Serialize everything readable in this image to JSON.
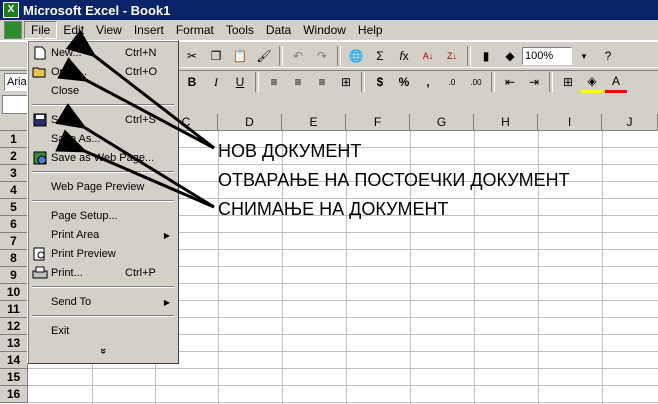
{
  "window": {
    "title": "Microsoft Excel - Book1"
  },
  "menu": [
    "File",
    "Edit",
    "View",
    "Insert",
    "Format",
    "Tools",
    "Data",
    "Window",
    "Help"
  ],
  "toolbar": {
    "zoom": "100%",
    "font_name": "Aria"
  },
  "columns": [
    "C",
    "D",
    "E",
    "F",
    "G",
    "H",
    "I",
    "J"
  ],
  "rows": [
    "1",
    "2",
    "3",
    "4",
    "5",
    "6",
    "7",
    "8",
    "9",
    "10",
    "11",
    "12",
    "13",
    "14",
    "15",
    "16"
  ],
  "file_menu": {
    "items": [
      {
        "label": "New...",
        "shortcut": "Ctrl+N",
        "icon": "new-document-icon"
      },
      {
        "label": "Open...",
        "shortcut": "Ctrl+O",
        "icon": "open-folder-icon"
      },
      {
        "label": "Close",
        "shortcut": ""
      },
      {
        "label": "Save",
        "shortcut": "Ctrl+S",
        "icon": "save-disk-icon"
      },
      {
        "label": "Save As...",
        "shortcut": ""
      },
      {
        "label": "Save as Web Page...",
        "shortcut": "",
        "icon": "web-page-icon"
      },
      {
        "label": "Web Page Preview",
        "shortcut": ""
      },
      {
        "label": "Page Setup...",
        "shortcut": ""
      },
      {
        "label": "Print Area",
        "shortcut": ""
      },
      {
        "label": "Print Preview",
        "shortcut": "",
        "icon": "print-preview-icon"
      },
      {
        "label": "Print...",
        "shortcut": "Ctrl+P",
        "icon": "printer-icon"
      },
      {
        "label": "Send To",
        "shortcut": ""
      },
      {
        "label": "Exit",
        "shortcut": ""
      }
    ],
    "expand": "»"
  },
  "annotations": {
    "new_doc": "НОВ ДОКУМЕНТ",
    "open_doc": "ОТВАРАЊЕ НА ПОСТОЕЧКИ ДОКУМЕНТ",
    "save_doc": "СНИМАЊЕ НА ДОКУМЕНТ"
  }
}
